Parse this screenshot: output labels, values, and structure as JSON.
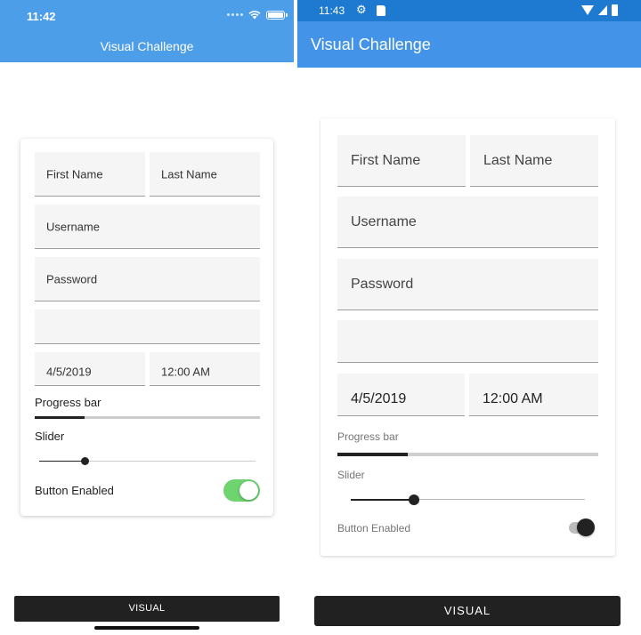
{
  "ios": {
    "status_time": "11:42",
    "title": "Visual Challenge",
    "fields": {
      "first_name_placeholder": "First Name",
      "last_name_placeholder": "Last Name",
      "username_placeholder": "Username",
      "password_placeholder": "Password",
      "empty_field_value": "",
      "date_value": "4/5/2019",
      "time_value": "12:00 AM"
    },
    "progress_label": "Progress bar",
    "progress_value": 0.22,
    "slider_label": "Slider",
    "slider_value": 0.21,
    "switch_label": "Button Enabled",
    "switch_on": true,
    "button_label": "VISUAL"
  },
  "android": {
    "status_time": "11:43",
    "title": "Visual Challenge",
    "fields": {
      "first_name_placeholder": "First Name",
      "last_name_placeholder": "Last Name",
      "username_placeholder": "Username",
      "password_placeholder": "Password",
      "empty_field_value": "",
      "date_value": "4/5/2019",
      "time_value": "12:00 AM"
    },
    "progress_label": "Progress bar",
    "progress_value": 0.27,
    "slider_label": "Slider",
    "slider_value": 0.27,
    "switch_label": "Button Enabled",
    "switch_on": true,
    "button_label": "VISUAL"
  },
  "colors": {
    "ios_header": "#4d9ee9",
    "android_status_bar": "#1e7ad0",
    "android_app_bar": "#4394e8",
    "ios_switch_on": "#6dd46f",
    "button_bg": "#212121"
  },
  "icons": {
    "ios_status": [
      "signal-dots-icon",
      "wifi-icon",
      "battery-icon"
    ],
    "android_status": [
      "settings-gear-icon",
      "sd-card-icon",
      "wifi-icon",
      "cell-signal-icon",
      "battery-icon"
    ]
  }
}
